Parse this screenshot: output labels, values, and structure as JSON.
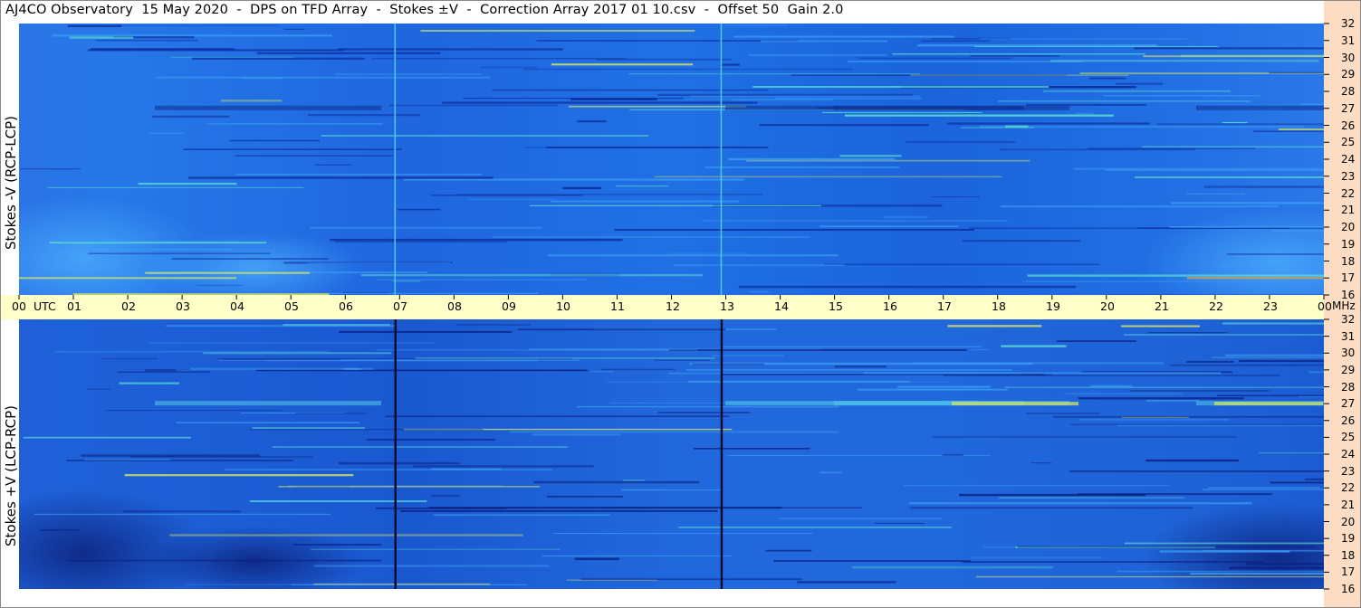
{
  "title": "AJ4CO Observatory  15 May 2020  -  DPS on TFD Array  -  Stokes ±V  -  Correction Array 2017 01 10.csv  -  Offset 50  Gain 2.0",
  "colors": {
    "background": "#ffffff",
    "axis_strip": "#ffffc8",
    "freq_strip": "#fcdcc3",
    "base_blue": "#1f66e0"
  },
  "chart_data": [
    {
      "type": "heatmap",
      "panel": "top",
      "ylabel": "Stokes -V (RCP-LCP)",
      "x_ticks": [
        "00",
        "UTC",
        "01",
        "02",
        "03",
        "04",
        "05",
        "06",
        "07",
        "08",
        "09",
        "10",
        "11",
        "12",
        "13",
        "14",
        "15",
        "16",
        "17",
        "18",
        "19",
        "20",
        "21",
        "22",
        "23",
        "00",
        "MHz"
      ],
      "x_range": [
        0,
        24
      ],
      "y_ticks": [
        "32",
        "31",
        "30",
        "29",
        "28",
        "27",
        "26",
        "25",
        "24",
        "23",
        "22",
        "21",
        "20",
        "19",
        "18",
        "17",
        "16"
      ],
      "y_range": [
        16,
        32
      ],
      "bright_lines_at": [
        6.92,
        12.92
      ]
    },
    {
      "type": "heatmap",
      "panel": "bottom",
      "ylabel": "Stokes +V (LCP-RCP)",
      "x_range": [
        0,
        24
      ],
      "y_ticks": [
        "32",
        "31",
        "30",
        "29",
        "28",
        "27",
        "26",
        "25",
        "24",
        "23",
        "22",
        "21",
        "20",
        "19",
        "18",
        "17",
        "16"
      ],
      "y_range": [
        16,
        32
      ],
      "dark_lines_at": [
        6.92,
        12.92
      ]
    }
  ]
}
